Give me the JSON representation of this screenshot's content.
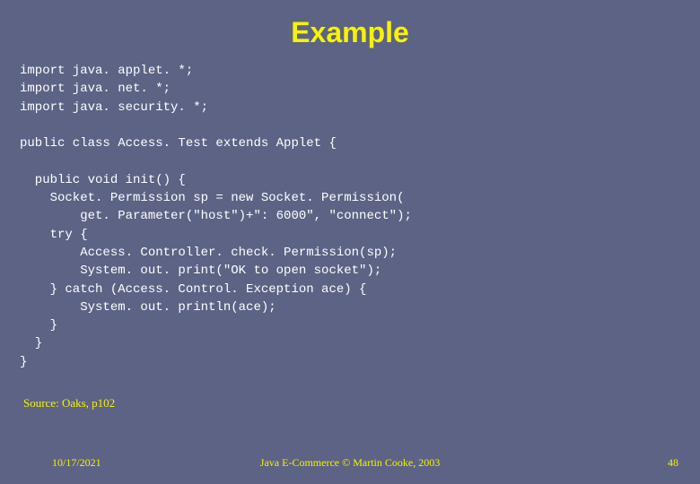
{
  "title": "Example",
  "code_lines": [
    "import java. applet. *;",
    "import java. net. *;",
    "import java. security. *;",
    "",
    "public class Access. Test extends Applet {",
    "",
    "  public void init() {",
    "    Socket. Permission sp = new Socket. Permission(",
    "        get. Parameter(\"host\")+\": 6000\", \"connect\");",
    "    try {",
    "        Access. Controller. check. Permission(sp);",
    "        System. out. print(\"OK to open socket\");",
    "    } catch (Access. Control. Exception ace) {",
    "        System. out. println(ace);",
    "    }",
    "  }",
    "}"
  ],
  "source": "Source: Oaks, p102",
  "footer": {
    "date": "10/17/2021",
    "center": "Java E-Commerce © Martin Cooke, 2003",
    "pagenum": "48"
  }
}
